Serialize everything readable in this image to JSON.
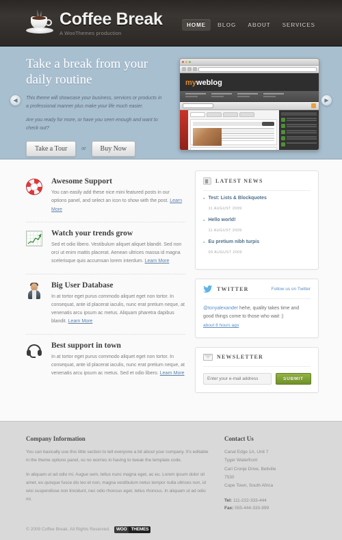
{
  "header": {
    "brand_title": "Coffee Break",
    "brand_tagline": "A WooThemes production",
    "logo_icon": "coffee-cup-icon",
    "nav": [
      {
        "label": "HOME",
        "active": true
      },
      {
        "label": "BLOG",
        "active": false
      },
      {
        "label": "ABOUT",
        "active": false
      },
      {
        "label": "SERVICES",
        "active": false
      }
    ]
  },
  "hero": {
    "heading": "Take a break from your daily routine",
    "paragraph1": "This theme will showcase your business, services or products in a professional manner plus make your life much easier.",
    "paragraph2": "Are you ready for more, or have you seen enough and want to check out?",
    "button_primary": "Take a Tour",
    "between_label": "or",
    "button_secondary": "Buy Now",
    "prev_arrow": "chevron-left-icon",
    "next_arrow": "chevron-right-icon",
    "screenshot_logo": "myweblog",
    "screenshot_logo_prefix": "my",
    "screenshot_logo_suffix": "weblog"
  },
  "features": [
    {
      "icon": "lifebuoy-icon",
      "title": "Awesome Support",
      "text": "You can easily add these nice mini featured posts in our options panel, and select an icon to show with the post.",
      "link": "Learn More"
    },
    {
      "icon": "line-chart-icon",
      "title": "Watch your trends grow",
      "text": "Sed et odio libero. Vestibulum aliquet aliquet blandit. Sed non orci ut enim mattis placerat. Aenean ultrices massa id magna scelerisque quis accumsan lorem interdum.",
      "link": "Learn More"
    },
    {
      "icon": "user-icon",
      "title": "Big User Database",
      "text": "In at tortor eget purus commodo aliquet eget non tortor. In consequat, ante id placerat iaculis, nunc erat pretium neque, at venenatis arcu ipsum ac metus. Aliquam pharetra dapibus blandit.",
      "link": "Learn More"
    },
    {
      "icon": "headset-icon",
      "title": "Best support in town",
      "text": "In at tortor eget purus commodo aliquet eget non tortor. In consequat, ante id placerat iaculis, nunc erat pretium neque, at venenatis arcu ipsum ac metus. Sed et odio libero.",
      "link": "Learn More"
    }
  ],
  "sidebar": {
    "latest_news": {
      "icon": "news-icon",
      "title": "LATEST NEWS",
      "items": [
        {
          "title": "Test: Lists & Blockquotes",
          "date": "11 AUGUST 2009"
        },
        {
          "title": "Hello world!",
          "date": "11 AUGUST 2009"
        },
        {
          "title": "Eu pretium nibh turpis",
          "date": "09 AUGUST 2009"
        }
      ]
    },
    "twitter": {
      "icon": "twitter-bird-icon",
      "title": "TWITTER",
      "follow_link": "Follow us on Twitter",
      "handle": "@tonyalexander",
      "tweet_text": " hehe, quality takes time and good things come to those who wait :)",
      "timestamp": "about 8 hours ago"
    },
    "newsletter": {
      "icon": "mail-icon",
      "title": "NEWSLETTER",
      "placeholder": "Enter your e-mail address",
      "submit_label": "SUBMIT"
    }
  },
  "footer": {
    "company": {
      "heading": "Company Information",
      "paragraph1": "You can basically use this little section to tell everyone a bit about your company. It's editable in the theme options panel, so no worries in having to tweak the template code.",
      "paragraph2": "In aliquam ut ad odio mi. Augue sem, tellus nunc magna eget, ac eu. Lorem ipsum dolor sit amet, eu quisque fusce dis leo et non, magna vestibulum netus tempor nulla ultrices non, id wisi suspendisse non tincidunt, nec odio rhoncus eget, tellus rhoncus. In aliquam ut ad odio mi."
    },
    "contact": {
      "heading": "Contact Us",
      "address": [
        "Canal Edge 1A, Unit 7",
        "Tyger Waterfront",
        "Carl Cronje Drive, Bellville",
        "7530",
        "Cape Town, South Africa"
      ],
      "tel_label": "Tel:",
      "tel_value": " 111-222-333-444",
      "fax_label": "Fax:",
      "fax_value": " 555-444-333-999"
    },
    "copyright": "© 2009 Coffee Break. All Rights Reserved.",
    "woo_logo_part1": "WOO",
    "woo_logo_part2": "THEMES"
  },
  "colors": {
    "header_dark": "#2f2b28",
    "hero_blue": "#a8bfd0",
    "accent_link": "#5a8fc0",
    "submit_green": "#7f9f34",
    "footer_gray": "#d9d9d9"
  }
}
